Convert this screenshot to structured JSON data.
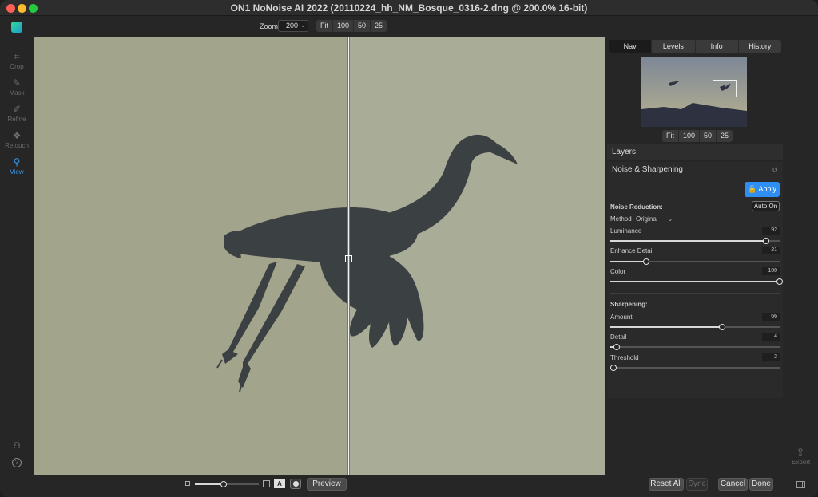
{
  "window": {
    "title": "ON1 NoNoise AI 2022 (20110224_hh_NM_Bosque_0316-2.dng @ 200.0% 16-bit)"
  },
  "toolbar": {
    "zoom_label": "Zoom",
    "zoom_value": "200",
    "zoom_presets": [
      "Fit",
      "100",
      "50",
      "25"
    ]
  },
  "left_tools": [
    {
      "label": "Crop",
      "icon": "crop-icon",
      "active": false
    },
    {
      "label": "Mask",
      "icon": "mask-brush-icon",
      "active": false
    },
    {
      "label": "Refine",
      "icon": "refine-brush-icon",
      "active": false
    },
    {
      "label": "Retouch",
      "icon": "retouch-icon",
      "active": false
    },
    {
      "label": "View",
      "icon": "view-zoom-icon",
      "active": true
    }
  ],
  "right_panel": {
    "tabs": [
      "Nav",
      "Levels",
      "Info",
      "History"
    ],
    "active_tab": "Nav",
    "nav_zoom_presets": [
      "Fit",
      "100",
      "50",
      "25"
    ],
    "layers_title": "Layers",
    "filter_title": "Noise & Sharpening",
    "apply_label": "Apply",
    "noise_reduction": {
      "heading": "Noise Reduction:",
      "auto_label": "Auto On",
      "method_label": "Method",
      "method_value": "Original",
      "sliders": [
        {
          "label": "Luminance",
          "value": "92",
          "fraction": 0.92
        },
        {
          "label": "Enhance Detail",
          "value": "21",
          "fraction": 0.21
        },
        {
          "label": "Color",
          "value": "100",
          "fraction": 1.0
        }
      ]
    },
    "sharpening": {
      "heading": "Sharpening:",
      "sliders": [
        {
          "label": "Amount",
          "value": "66",
          "fraction": 0.66
        },
        {
          "label": "Detail",
          "value": "4",
          "fraction": 0.04
        },
        {
          "label": "Threshold",
          "value": "2",
          "fraction": 0.02
        }
      ]
    }
  },
  "bottom": {
    "preview_label": "Preview",
    "reset_all_label": "Reset All",
    "sync_label": "Sync",
    "cancel_label": "Cancel",
    "done_label": "Done",
    "export_label": "Export",
    "view_slider_fraction": 0.45
  },
  "colors": {
    "accent": "#2f8ef4",
    "active_tool": "#3d9bf0"
  }
}
